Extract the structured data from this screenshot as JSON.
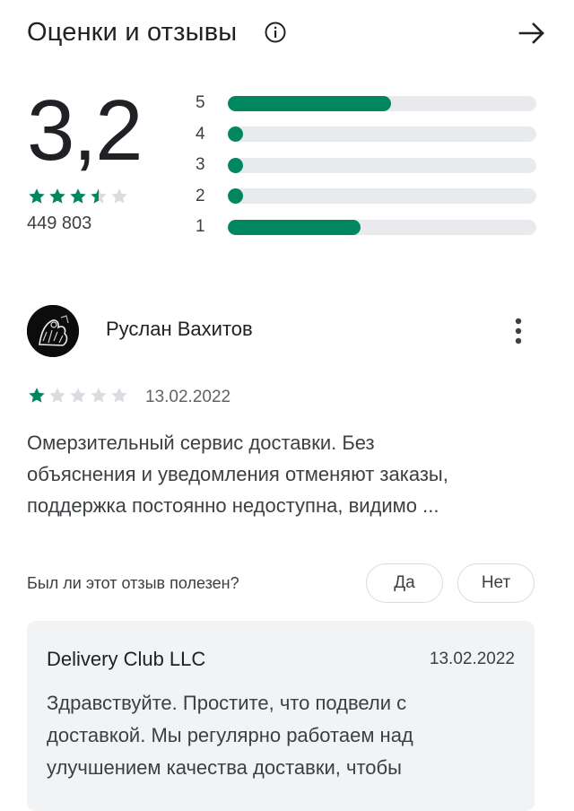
{
  "header": {
    "title": "Оценки и отзывы",
    "info_icon": "info-icon",
    "arrow_icon": "arrow-right-icon"
  },
  "summary": {
    "score": "3,2",
    "stars_filled": 3.5,
    "stars_total": 5,
    "rating_count": "449 803",
    "histogram": [
      {
        "label": "5",
        "fraction": 0.53
      },
      {
        "label": "4",
        "fraction": 0.05
      },
      {
        "label": "3",
        "fraction": 0.05
      },
      {
        "label": "2",
        "fraction": 0.05
      },
      {
        "label": "1",
        "fraction": 0.43
      }
    ]
  },
  "review": {
    "author": "Руслан Вахитов",
    "avatar_icon": "avatar",
    "more_icon": "more-vert-icon",
    "stars": 1,
    "date": "13.02.2022",
    "lines": [
      "Омерзительный сервис доставки. Без",
      "объяснения и уведомления отменяют заказы,",
      "поддержка постоянно недоступна, видимо ..."
    ]
  },
  "helpful": {
    "question": "Был ли этот отзыв полезен?",
    "yes_label": "Да",
    "no_label": "Нет"
  },
  "reply": {
    "developer": "Delivery Club LLC",
    "date": "13.02.2022",
    "lines": [
      "Здравствуйте. Простите, что подвели с",
      "доставкой. Мы регулярно работаем над",
      "улучшением качества доставки, чтобы"
    ]
  },
  "colors": {
    "accent": "#01875f",
    "track": "#e8eaed",
    "star_empty": "#dadce0",
    "reply_bg": "#f1f3f4"
  }
}
